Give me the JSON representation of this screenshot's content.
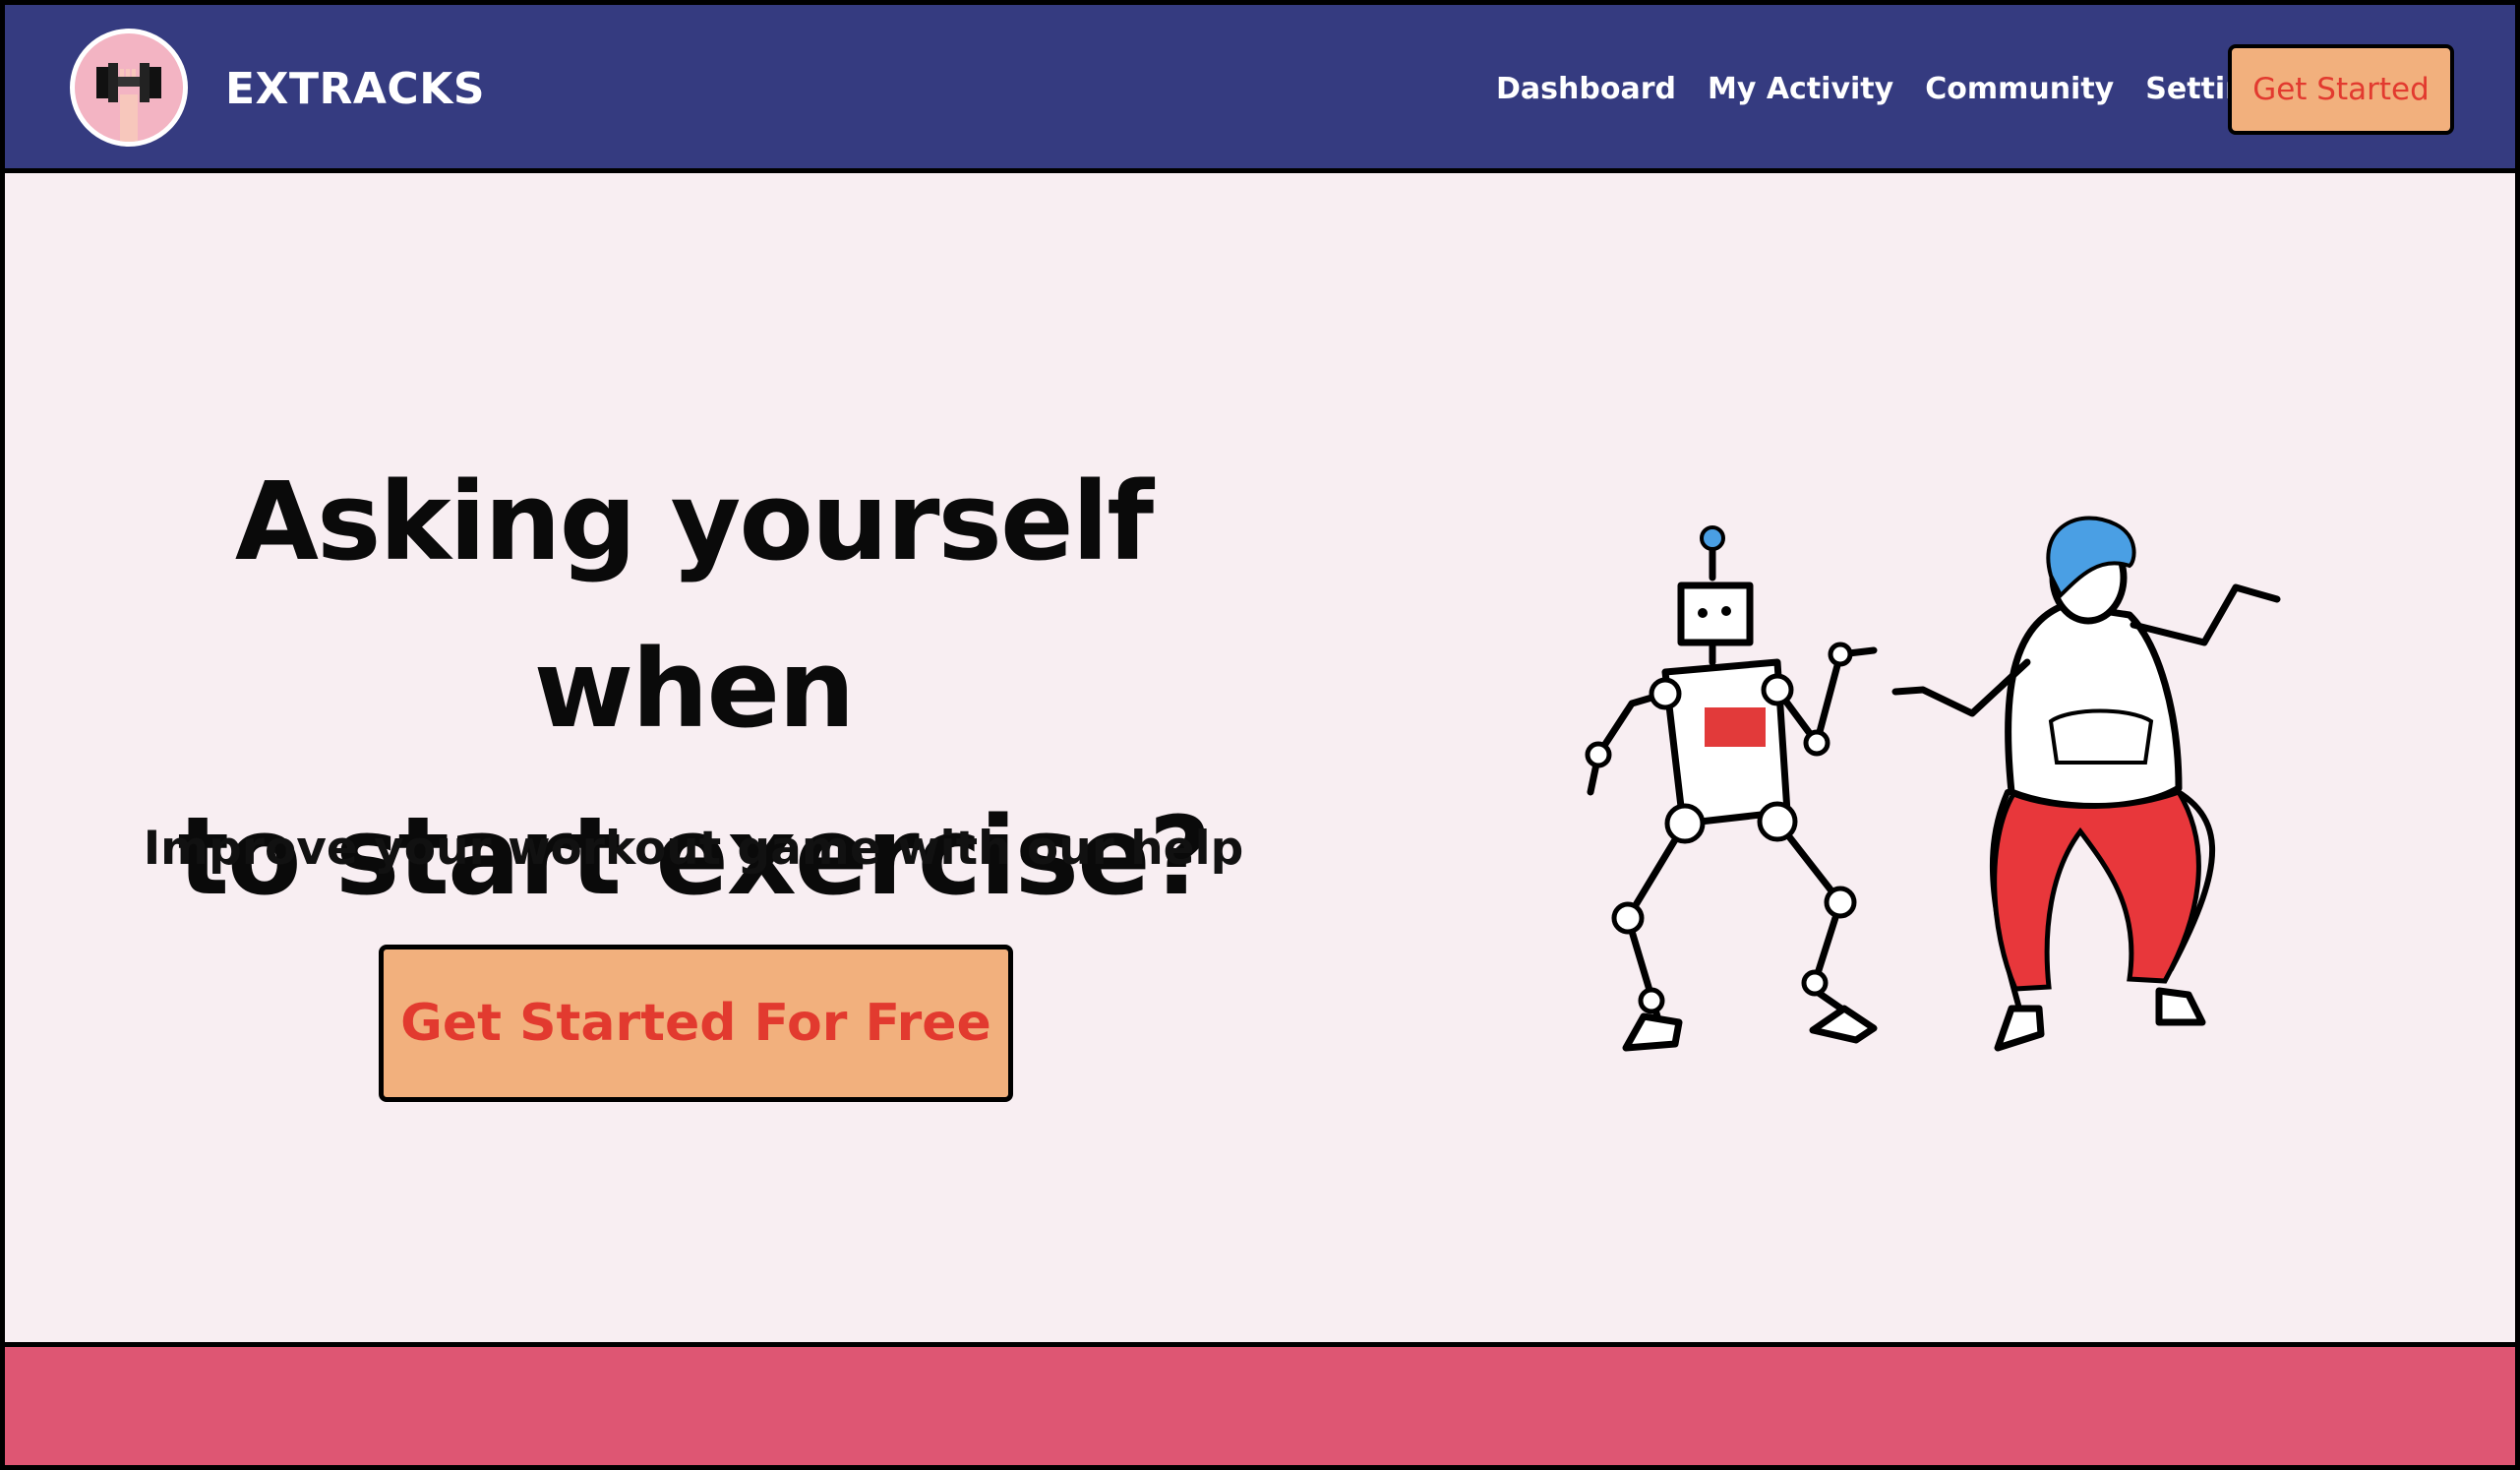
{
  "brand": {
    "name": "EXTRACKS"
  },
  "nav": {
    "items": [
      "Dashboard",
      "My Activity",
      "Community",
      "Setting"
    ],
    "cta_label": "Get Started"
  },
  "hero": {
    "title_line1": "Asking yourself when",
    "title_line2": "to start exercise?",
    "subtitle": "Improve your workout game with our help",
    "cta_label": "Get Started For Free"
  },
  "colors": {
    "nav_bg": "#353b80",
    "page_bg": "#f8eef2",
    "cta_bg": "#f2b07d",
    "cta_text": "#e23a2f",
    "band": "#de5673"
  },
  "icons": {
    "logo": "dumbbell-logo-icon",
    "illustration": "robot-and-person-dancing-illustration"
  }
}
